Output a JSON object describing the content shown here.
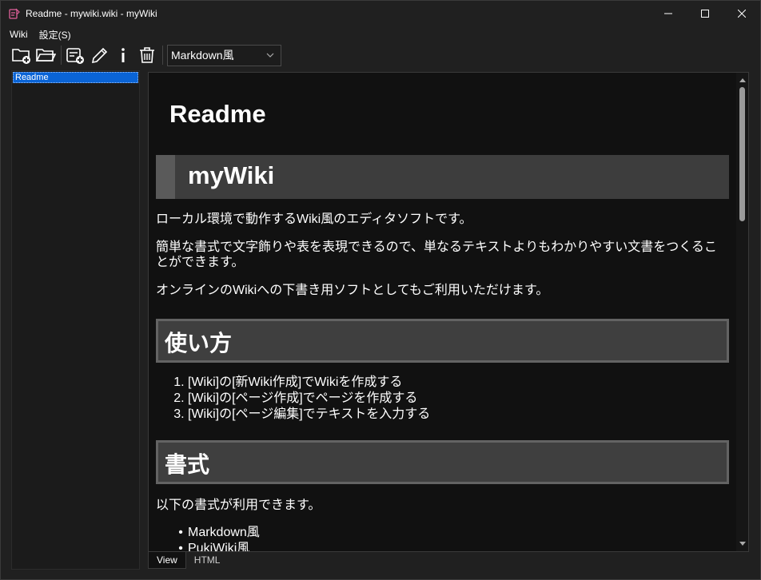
{
  "window": {
    "title": "Readme - mywiki.wiki - myWiki"
  },
  "menu": {
    "items": [
      "Wiki",
      "設定(S)"
    ]
  },
  "toolbar": {
    "buttons": [
      "new-wiki-icon",
      "open-folder-icon",
      "new-page-icon",
      "edit-pencil-icon",
      "info-icon",
      "trash-icon"
    ],
    "format_value": "Markdown風"
  },
  "sidebar": {
    "items": [
      {
        "label": "Readme",
        "selected": true
      }
    ]
  },
  "content": {
    "page_title": "Readme",
    "h1": "myWiki",
    "paragraphs": [
      "ローカル環境で動作するWiki風のエディタソフトです。",
      "簡単な書式で文字飾りや表を表現できるので、単なるテキストよりもわかりやすい文書をつくることができます。",
      "オンラインのWikiへの下書き用ソフトとしてもご利用いただけます。"
    ],
    "section_usage": {
      "heading": "使い方",
      "steps": [
        "[Wiki]の[新Wiki作成]でWikiを作成する",
        "[Wiki]の[ページ作成]でページを作成する",
        "[Wiki]の[ページ編集]でテキストを入力する"
      ]
    },
    "section_format": {
      "heading": "書式",
      "intro": "以下の書式が利用できます。",
      "items": [
        "Markdown風",
        "PukiWiki風"
      ]
    }
  },
  "tabs": [
    {
      "label": "View",
      "active": true
    },
    {
      "label": "HTML",
      "active": false
    }
  ],
  "colors": {
    "selection": "#0a64d6",
    "heading_bg": "#3d3d3d",
    "background": "#202020"
  }
}
